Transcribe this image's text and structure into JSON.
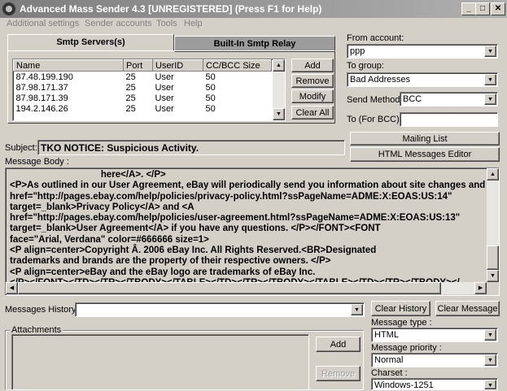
{
  "window": {
    "title": "Advanced Mass Sender 4.3     [UNREGISTERED]     (Press F1 for Help)",
    "minimize": "_",
    "maximize": "□",
    "close": "✕"
  },
  "menu": [
    "Additional settings",
    "Sender accounts",
    "Tools",
    "Help"
  ],
  "tabs": {
    "smtp": "Smtp Servers(s)",
    "relay": "Built-In Smtp Relay"
  },
  "servers": {
    "columns": [
      "Name",
      "Port",
      "UserID",
      "CC/BCC Size"
    ],
    "rows": [
      [
        "87.48.199.190",
        "25",
        "User",
        "50"
      ],
      [
        "87.98.171.37",
        "25",
        "User",
        "50"
      ],
      [
        "87.98.171.39",
        "25",
        "User",
        "50"
      ],
      [
        "194.2.146.26",
        "25",
        "User",
        "50"
      ]
    ],
    "buttons": {
      "add": "Add",
      "remove": "Remove",
      "modify": "Modify",
      "clear_all": "Clear All"
    }
  },
  "right_panel": {
    "from_account_label": "From account:",
    "from_account_value": "ppp",
    "to_group_label": "To group:",
    "to_group_value": "Bad Addresses",
    "send_method_label": "Send Method:",
    "send_method_value": "BCC",
    "to_bcc_label": "To (For BCC)",
    "to_bcc_value": "",
    "mailing_list": "Mailing List",
    "html_editor": "HTML Messages Editor"
  },
  "subject": {
    "label": "Subject:",
    "value": "TKO NOTICE: Suspicious Activity."
  },
  "message_body": {
    "label": "Message Body :",
    "text": "                                   here</A>. </P>\n<P>As outlined in our User Agreement, eBay will periodically send you information about site changes and enha\nhref=\"http://pages.ebay.com/help/policies/privacy-policy.html?ssPageName=ADME:X:EOAS:US:14\"\ntarget=_blank>Privacy Policy</A> and <A\nhref=\"http://pages.ebay.com/help/policies/user-agreement.html?ssPageName=ADME:X:EOAS:US:13\"\ntarget=_blank>User Agreement</A> if you have any questions. </P></FONT><FONT\nface=\"Arial, Verdana\" color=#666666 size=1>\n<P align=center>Copyright Â. 2006 eBay Inc. All Rights Reserved.<BR>Designated\ntrademarks and brands are the property of their respective owners. </P>\n<P align=center>eBay and the eBay logo are trademarks of eBay Inc.\n</P></FONT></TD></TR></TBODY></TABLE></TD></TR></TBODY></TABLE></TD></TR></TBODY></"
  },
  "history": {
    "label": "Messages History:",
    "value": "",
    "clear_history": "Clear History",
    "clear_message": "Clear Message"
  },
  "attachments": {
    "label": "Attachments",
    "add": "Add",
    "remove": "Remove"
  },
  "options": {
    "message_type_label": "Message type :",
    "message_type_value": "HTML",
    "priority_label": "Message priority :",
    "priority_value": "Normal",
    "charset_label": "Charset :",
    "charset_value": "Windows-1251"
  },
  "icons": {
    "app": "app-icon",
    "scroll_up": "▲",
    "scroll_down": "▼",
    "scroll_left": "◀",
    "scroll_right": "▶",
    "dropdown": "▼"
  }
}
